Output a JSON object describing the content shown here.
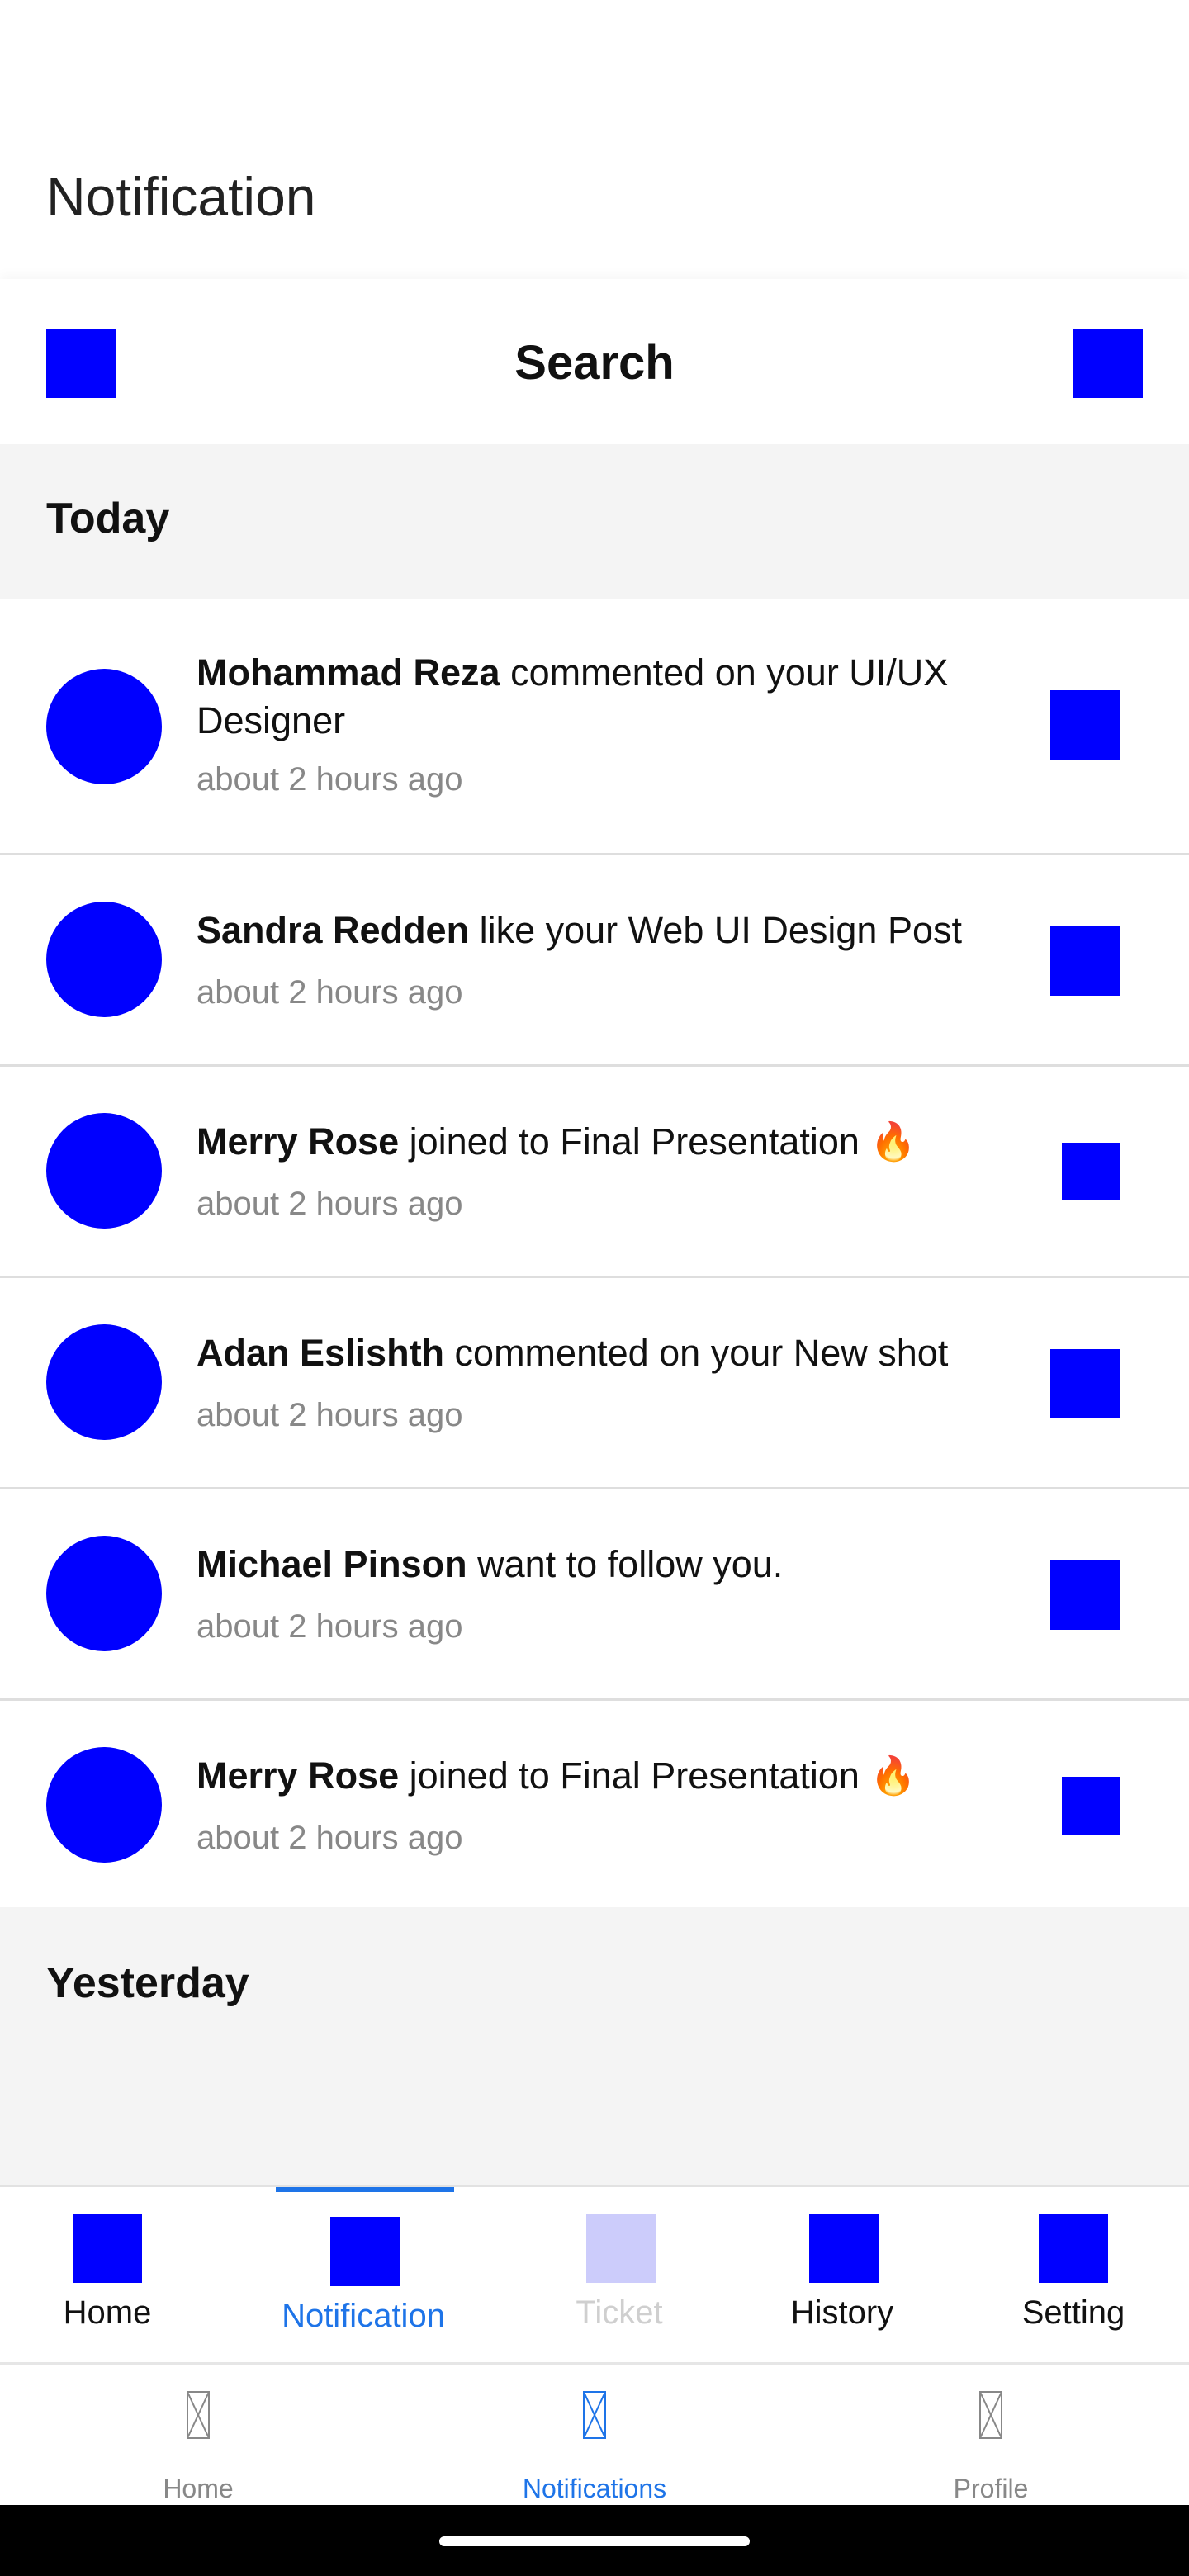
{
  "header": {
    "title": "Notification"
  },
  "search": {
    "label": "Search"
  },
  "sections": {
    "today": "Today",
    "yesterday": "Yesterday"
  },
  "notifications": [
    {
      "name": "Mohammad Reza",
      "message": " commented on your UI/UX Designer",
      "time": "about 2 hours ago"
    },
    {
      "name": "Sandra Redden",
      "message": " like your Web UI Design Post",
      "time": "about 2 hours ago"
    },
    {
      "name": "Merry Rose",
      "message": " joined to Final Presentation 🔥",
      "time": "about 2 hours ago"
    },
    {
      "name": "Adan Eslishth",
      "message": " commented on your New shot",
      "time": "about 2 hours ago"
    },
    {
      "name": "Michael Pinson",
      "message": " want to follow you.",
      "time": "about 2 hours ago"
    },
    {
      "name": "Merry Rose",
      "message": " joined to Final Presentation 🔥",
      "time": "about 2 hours ago"
    }
  ],
  "tabs": [
    {
      "label": "Home",
      "state": "normal"
    },
    {
      "label": "Notification",
      "state": "active"
    },
    {
      "label": "Ticket",
      "state": "disabled"
    },
    {
      "label": "History",
      "state": "normal"
    },
    {
      "label": "Setting",
      "state": "normal"
    }
  ],
  "bottom_nav": [
    {
      "label": "Home",
      "state": "normal"
    },
    {
      "label": "Notifications",
      "state": "active"
    },
    {
      "label": "Profile",
      "state": "normal"
    }
  ],
  "colors": {
    "placeholder_blue": "#0000ff",
    "accent": "#1e74e8",
    "section_bg": "#f4f4f4",
    "muted_text": "#888888"
  }
}
